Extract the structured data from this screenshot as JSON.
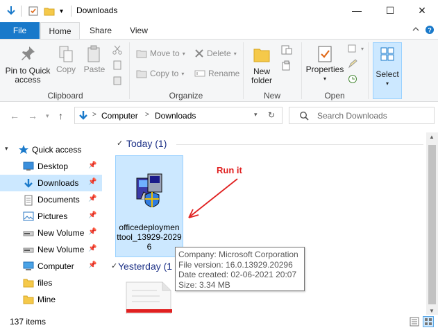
{
  "window": {
    "title": "Downloads",
    "minimize_glyph": "—",
    "maximize_glyph": "☐",
    "close_glyph": "✕"
  },
  "ribbon_tabs": {
    "file": "File",
    "home": "Home",
    "share": "Share",
    "view": "View"
  },
  "ribbon": {
    "clipboard": {
      "label": "Clipboard",
      "pin_label": "Pin to Quick access",
      "copy_label": "Copy",
      "paste_label": "Paste"
    },
    "organize": {
      "label": "Organize",
      "move_to": "Move to",
      "copy_to": "Copy to",
      "delete": "Delete",
      "rename": "Rename"
    },
    "new": {
      "label": "New",
      "new_folder": "New folder"
    },
    "open": {
      "label": "Open",
      "properties": "Properties"
    },
    "select": {
      "label": "Select"
    }
  },
  "address": {
    "computer": "Computer",
    "downloads": "Downloads",
    "separator": ">"
  },
  "search": {
    "placeholder": "Search Downloads"
  },
  "nav_pane": {
    "quick_access": "Quick access",
    "items": [
      {
        "label": "Desktop",
        "pinned": true
      },
      {
        "label": "Downloads",
        "pinned": true,
        "selected": true
      },
      {
        "label": "Documents",
        "pinned": true
      },
      {
        "label": "Pictures",
        "pinned": true
      },
      {
        "label": "New Volume",
        "pinned": true
      },
      {
        "label": "New Volume",
        "pinned": true
      },
      {
        "label": "Computer",
        "pinned": true
      },
      {
        "label": "files",
        "pinned": false
      },
      {
        "label": "Mine",
        "pinned": false
      }
    ]
  },
  "content": {
    "today_group": "Today (1)",
    "yesterday_group": "Yesterday (1",
    "file_name": "officedeploymenttool_13929-20296",
    "file_name_lines": [
      "officedeploymen",
      "ttool_13929-2029",
      "6"
    ]
  },
  "tooltip": {
    "company": "Company: Microsoft Corporation",
    "version": "File version: 16.0.13929.20296",
    "date": "Date created: 02-06-2021 20:07",
    "size": "Size: 3.34 MB"
  },
  "annotation": {
    "text": "Run it",
    "color": "#e02020"
  },
  "status": {
    "count": "137 items"
  },
  "colors": {
    "accent": "#1979ca",
    "selection": "#cce8ff",
    "group_header": "#1e3287"
  }
}
